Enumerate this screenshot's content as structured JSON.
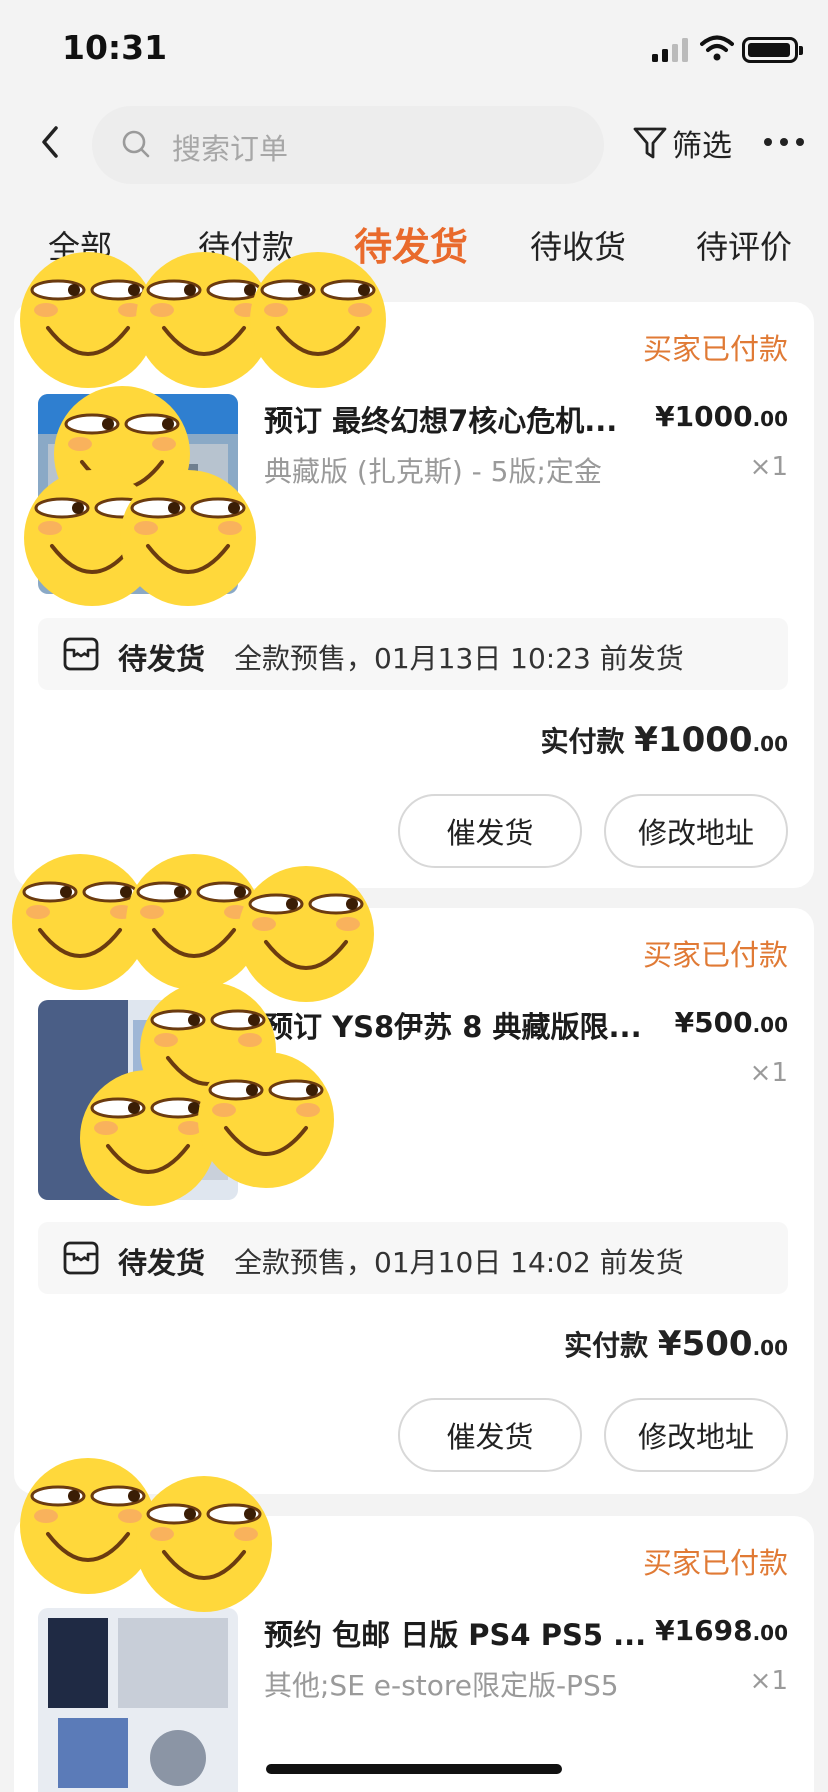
{
  "status_bar": {
    "time": "10:31"
  },
  "header": {
    "search_placeholder": "搜索订单",
    "filter_label": "筛选"
  },
  "tabs": [
    {
      "label": "全部"
    },
    {
      "label": "待付款"
    },
    {
      "label": "待发货",
      "active": true
    },
    {
      "label": "待收货"
    },
    {
      "label": "待评价"
    }
  ],
  "orders": [
    {
      "status": "买家已付款",
      "title": "预订 最终幻想7核心危机...",
      "spec": "典藏版 (扎克斯) - 5版;定金",
      "price_int": "¥1000",
      "price_dec": ".00",
      "qty": "×1",
      "ship_state": "待发货",
      "ship_info": "全款预售，01月13日 10:23 前发货",
      "total_label": "实付款",
      "total_int": "¥1000",
      "total_dec": ".00",
      "btn_urge": "催发货",
      "btn_addr": "修改地址"
    },
    {
      "status": "买家已付款",
      "title": "预订 YS8伊苏 8 典藏版限...",
      "spec": "",
      "price_int": "¥500",
      "price_dec": ".00",
      "qty": "×1",
      "ship_state": "待发货",
      "ship_info": "全款预售，01月10日 14:02 前发货",
      "total_label": "实付款",
      "total_int": "¥500",
      "total_dec": ".00",
      "btn_urge": "催发货",
      "btn_addr": "修改地址"
    },
    {
      "status": "买家已付款",
      "title": "预约 包邮 日版 PS4 PS5 ...",
      "spec": "其他;SE e-store限定版-PS5",
      "price_int": "¥1698",
      "price_dec": ".00",
      "qty": "×1"
    }
  ],
  "colors": {
    "accent": "#e96a2c",
    "status": "#e07a35",
    "bg": "#f3f3f3",
    "emoji": "#ffd83b"
  }
}
